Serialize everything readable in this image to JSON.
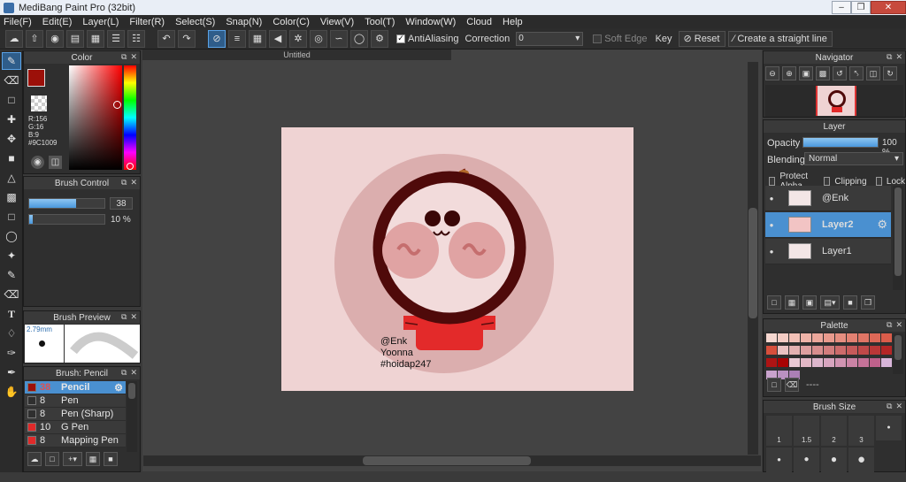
{
  "app": {
    "title": "MediBang Paint Pro (32bit)"
  },
  "menu": [
    "File(F)",
    "Edit(E)",
    "Layer(L)",
    "Filter(R)",
    "Select(S)",
    "Snap(N)",
    "Color(C)",
    "View(V)",
    "Tool(T)",
    "Window(W)",
    "Cloud",
    "Help"
  ],
  "toolbar": {
    "antialiasing_label": "AntiAliasing",
    "correction_label": "Correction",
    "correction_value": "0",
    "soft_edge_label": "Soft Edge",
    "key_label": "Key",
    "reset_label": "Reset",
    "straight_line_label": "Create a straight line"
  },
  "color_panel": {
    "title": "Color",
    "r": "R:156",
    "g": "G:16",
    "b": "B:9",
    "hex": "#9C1009",
    "foreground": "#9c1009"
  },
  "brush_control": {
    "title": "Brush Control",
    "size": "38",
    "opacity": "10 %",
    "size_fraction": 0.62,
    "opacity_fraction": 0.05
  },
  "brush_preview": {
    "title": "Brush Preview",
    "size_text": "2.79mm"
  },
  "brush_list": {
    "title": "Brush: Pencil",
    "items": [
      {
        "size": "38",
        "name": "Pencil",
        "color": "#9c1009",
        "selected": true
      },
      {
        "size": "8",
        "name": "Pen",
        "color": "#2f2f2f",
        "selected": false
      },
      {
        "size": "8",
        "name": "Pen (Sharp)",
        "color": "#2f2f2f",
        "selected": false
      },
      {
        "size": "10",
        "name": "G Pen",
        "color": "#e02a2a",
        "selected": false
      },
      {
        "size": "8",
        "name": "Mapping Pen",
        "color": "#e02a2a",
        "selected": false
      }
    ]
  },
  "document": {
    "tab": "Untitled",
    "caption": [
      "@Enk",
      "Yoonna",
      "#hoidap247"
    ]
  },
  "navigator": {
    "title": "Navigator"
  },
  "layer_panel": {
    "title": "Layer",
    "opacity_label": "Opacity",
    "opacity_value": "100 %",
    "opacity_fraction": 1.0,
    "blending_label": "Blending",
    "blending_value": "Normal",
    "protect_alpha": "Protect Alpha",
    "clipping": "Clipping",
    "lock": "Lock",
    "layers": [
      {
        "name": "@Enk",
        "selected": false
      },
      {
        "name": "Layer2",
        "selected": true
      },
      {
        "name": "Layer1",
        "selected": false
      }
    ]
  },
  "palette": {
    "title": "Palette",
    "name": "----",
    "colors": [
      "#f6d7d0",
      "#f4ccc4",
      "#f2c0b6",
      "#efb3a8",
      "#eca79b",
      "#e99a8d",
      "#e68e80",
      "#e38172",
      "#e07565",
      "#dd6857",
      "#da5c4a",
      "#d74f3c",
      "#eac2c2",
      "#e4b1b1",
      "#de9f9f",
      "#d88e8e",
      "#d27d7d",
      "#cc6b6b",
      "#c65a5a",
      "#c04949",
      "#ba3737",
      "#b42626",
      "#ae1414",
      "#a80303",
      "#e9c9d4",
      "#e3b8c6",
      "#ddb6cc",
      "#d7a5bf",
      "#d194b2",
      "#cb83a5",
      "#c57298",
      "#bf618b",
      "#d8b5d9",
      "#c9a3cd",
      "#ba91c1",
      "#ab7fb5"
    ]
  },
  "brush_size_panel": {
    "title": "Brush Size",
    "labels": [
      "1",
      "1.5",
      "2",
      "3"
    ]
  }
}
